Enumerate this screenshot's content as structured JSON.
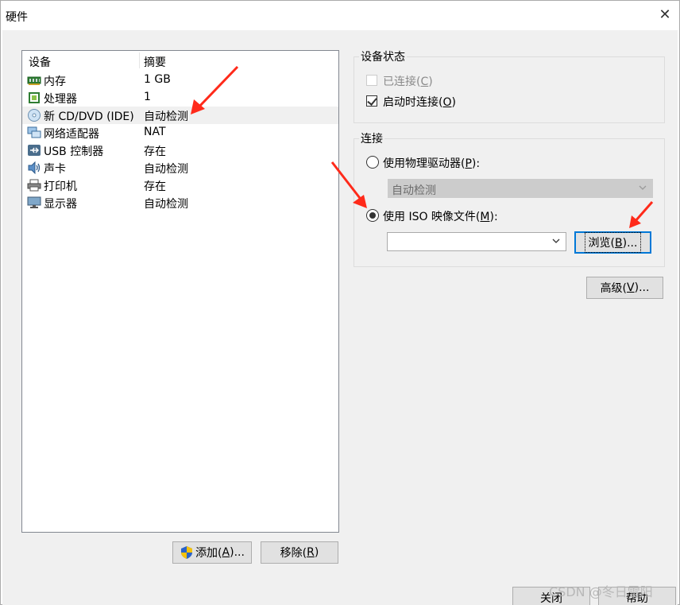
{
  "window": {
    "title": "硬件"
  },
  "device_list": {
    "headers": {
      "device": "设备",
      "summary": "摘要"
    },
    "rows": [
      {
        "name": "内存",
        "summary": "1 GB",
        "icon": "memory-icon"
      },
      {
        "name": "处理器",
        "summary": "1",
        "icon": "processor-icon"
      },
      {
        "name": "新 CD/DVD (IDE)",
        "summary": "自动检测",
        "icon": "cd-dvd-icon",
        "selected": true
      },
      {
        "name": "网络适配器",
        "summary": "NAT",
        "icon": "network-adapter-icon"
      },
      {
        "name": "USB 控制器",
        "summary": "存在",
        "icon": "usb-icon"
      },
      {
        "name": "声卡",
        "summary": "自动检测",
        "icon": "speaker-icon"
      },
      {
        "name": "打印机",
        "summary": "存在",
        "icon": "printer-icon"
      },
      {
        "name": "显示器",
        "summary": "自动检测",
        "icon": "monitor-icon"
      }
    ]
  },
  "buttons": {
    "add": {
      "text": "添加(",
      "key": "A",
      "tail": ")..."
    },
    "remove": {
      "text": "移除(",
      "key": "R",
      "tail": ")"
    },
    "browse": {
      "text": "浏览(",
      "key": "B",
      "tail": ")..."
    },
    "advanced": {
      "text": "高级(",
      "key": "V",
      "tail": ")..."
    },
    "close": "关闭",
    "help": "帮助"
  },
  "device_status": {
    "title": "设备状态",
    "connected": {
      "text": "已连接(",
      "key": "C",
      "tail": ")",
      "checked": false,
      "disabled": true
    },
    "connect_at_power_on": {
      "text": "启动时连接(",
      "key": "O",
      "tail": ")",
      "checked": true
    }
  },
  "connection": {
    "title": "连接",
    "physical": {
      "text": "使用物理驱动器(",
      "key": "P",
      "tail": "):",
      "selected": false
    },
    "physical_select_value": "自动检测",
    "iso": {
      "text": "使用 ISO 映像文件(",
      "key": "M",
      "tail": "):",
      "selected": true
    },
    "iso_path": ""
  },
  "watermark": "CSDN @冬日雪阳",
  "colors": {
    "accent": "#0078d7",
    "arrow": "#ff2a1a",
    "selected_row": "#f0f0f0"
  }
}
